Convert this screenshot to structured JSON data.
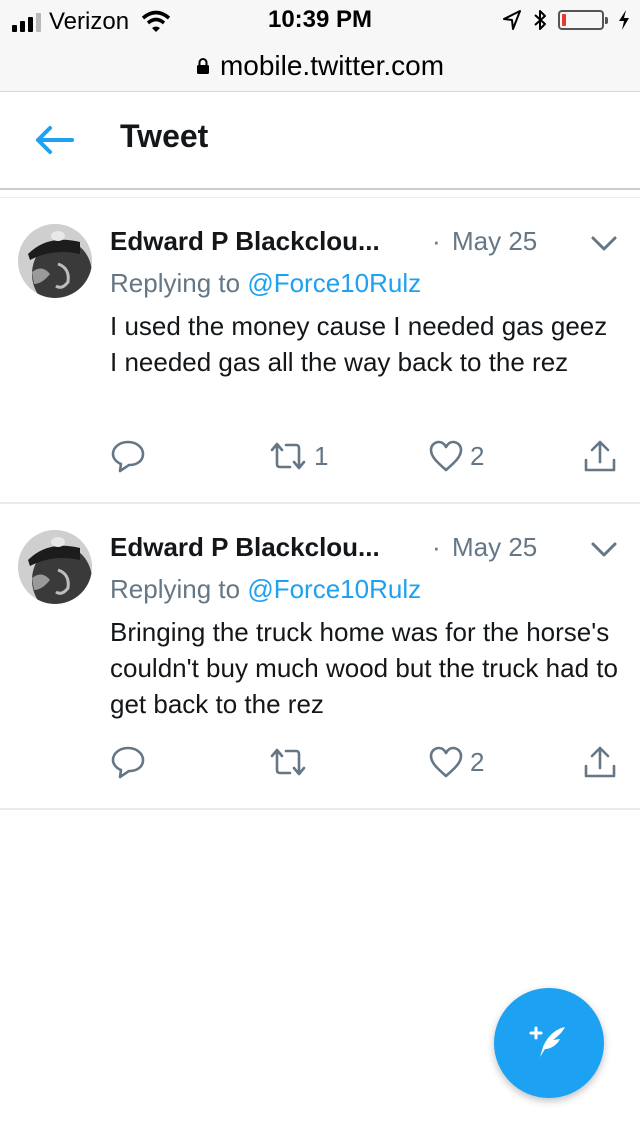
{
  "status_bar": {
    "carrier": "Verizon",
    "time": "10:39 PM",
    "icons": [
      "signal-icon",
      "wifi-icon",
      "location-icon",
      "bluetooth-icon",
      "battery-icon",
      "charging-icon"
    ],
    "battery_level_fraction": 0.1
  },
  "browser": {
    "url": "mobile.twitter.com",
    "lock_icon": "lock-icon"
  },
  "header": {
    "title": "Tweet",
    "back_icon": "back-arrow-icon"
  },
  "tweets": [
    {
      "author": "Edward P Blackclou...",
      "separator": "·",
      "date": "May 25",
      "replying_prefix": "Replying to",
      "replying_handle": "@Force10Rulz",
      "text": "I used the money cause I needed gas geez I needed gas all the way back to the rez",
      "reply_count": "",
      "retweet_count": "1",
      "like_count": "2"
    },
    {
      "author": "Edward P Blackclou...",
      "separator": "·",
      "date": "May 25",
      "replying_prefix": "Replying to",
      "replying_handle": "@Force10Rulz",
      "text": "Bringing the truck home was for the horse's couldn't buy much wood but the truck had to get back to the rez",
      "reply_count": "",
      "retweet_count": "",
      "like_count": "2"
    }
  ],
  "fab": {
    "icon": "compose-tweet-icon"
  },
  "colors": {
    "accent": "#1da1f2",
    "secondary_text": "#657786",
    "primary_text": "#14171a",
    "divider": "#e6ecf0"
  }
}
